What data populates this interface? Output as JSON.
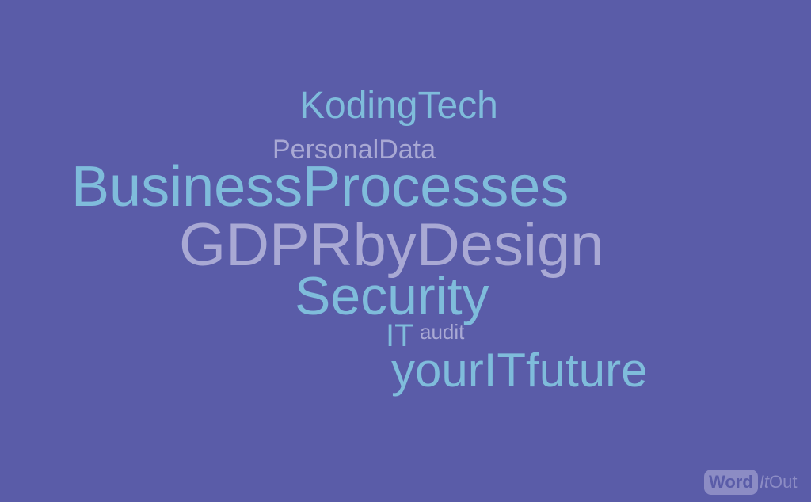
{
  "background": "#5a5ca8",
  "colors": {
    "blue": "#7fbcdb",
    "lavender": "#a9a9d4"
  },
  "words": {
    "kodingtech": "KodingTech",
    "personaldata": "PersonalData",
    "business": "BusinessProcesses",
    "gdpr": "GDPRbyDesign",
    "security": "Security",
    "it": "IT",
    "audit": "audit",
    "future": "yourITfuture"
  },
  "logo": {
    "word": "Word",
    "it": "It",
    "out": "Out"
  }
}
